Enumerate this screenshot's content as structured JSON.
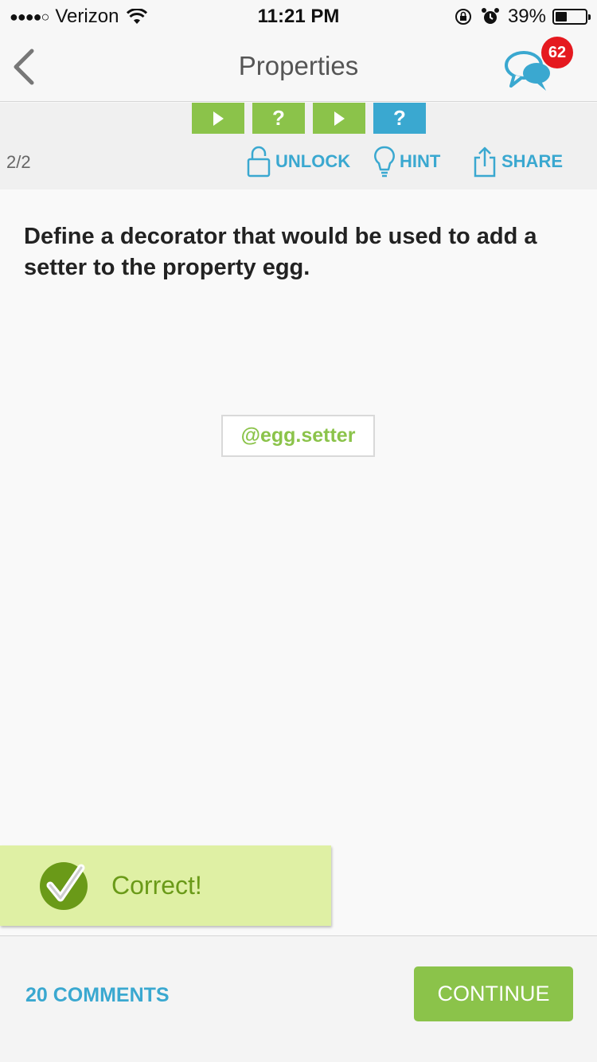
{
  "status_bar": {
    "signal_dots": "●●●●○",
    "carrier": "Verizon",
    "time": "11:21 PM",
    "battery_percent": "39%",
    "battery_level": 0.39
  },
  "nav": {
    "title": "Properties",
    "notification_count": "62"
  },
  "steps": [
    {
      "type": "play",
      "color": "#8bc34a"
    },
    {
      "type": "question",
      "label": "?",
      "color": "#8bc34a"
    },
    {
      "type": "play",
      "color": "#8bc34a"
    },
    {
      "type": "question",
      "label": "?",
      "color": "#3aa8d0"
    }
  ],
  "toolbar": {
    "page_counter": "2/2",
    "unlock_label": "UNLOCK",
    "hint_label": "HINT",
    "share_label": "SHARE"
  },
  "question": {
    "text": "Define a decorator that would be used to add a setter to the property egg."
  },
  "answer": {
    "value": "@egg.setter"
  },
  "feedback": {
    "label": "Correct!"
  },
  "footer": {
    "comments_label": "20 COMMENTS",
    "continue_label": "CONTINUE"
  },
  "colors": {
    "accent_green": "#8bc34a",
    "accent_blue": "#3aa8d0",
    "badge_red": "#e5191f",
    "banner_bg": "#dff0a4"
  }
}
